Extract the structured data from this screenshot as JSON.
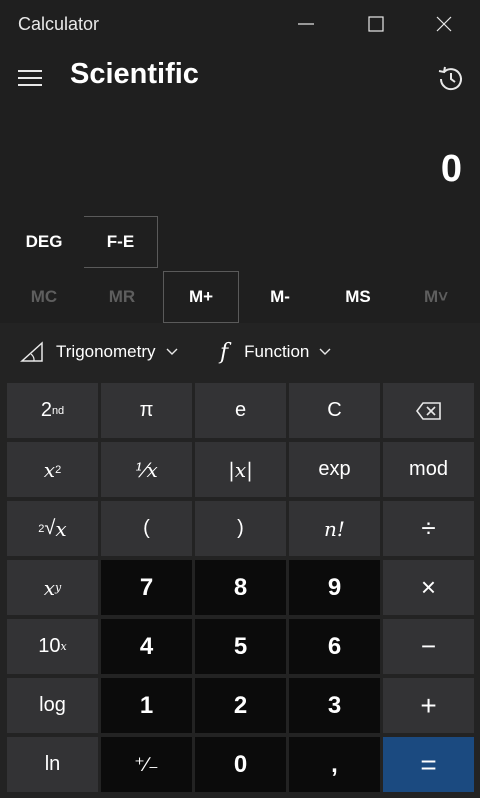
{
  "window": {
    "title": "Calculator"
  },
  "header": {
    "mode": "Scientific"
  },
  "display": {
    "value": "0"
  },
  "angle": {
    "deg": "DEG",
    "fe": "F-E"
  },
  "memory": {
    "mc": "MC",
    "mr": "MR",
    "mplus": "M+",
    "mminus": "M-",
    "ms": "MS",
    "mlist": "M˅"
  },
  "functions": {
    "trig": "Trigonometry",
    "func": "Function",
    "f": "f"
  },
  "keys": {
    "second_base": "2",
    "second_sup": "nd",
    "pi": "π",
    "e": "e",
    "clear": "C",
    "square_base": "x",
    "square_sup": "2",
    "reciprocal": "⅟x",
    "abs": "|x|",
    "exp": "exp",
    "mod": "mod",
    "sqrt_index": "2",
    "sqrt_sym": "√",
    "sqrt_x": "x",
    "lparen": "(",
    "rparen": ")",
    "factorial": "n!",
    "divide": "÷",
    "pow_base": "x",
    "pow_sup": "y",
    "seven": "7",
    "eight": "8",
    "nine": "9",
    "multiply": "×",
    "ten_base": "10",
    "ten_sup": "x",
    "four": "4",
    "five": "5",
    "six": "6",
    "minus": "−",
    "log": "log",
    "one": "1",
    "two": "2",
    "three": "3",
    "plus": "+",
    "ln": "ln",
    "negate": "⁺∕₋",
    "zero": "0",
    "decimal": ",",
    "equals": "="
  },
  "colors": {
    "background": "#1f1f1f",
    "function_key": "#333335",
    "number_key": "#0b0b0b",
    "equals_key": "#1b4a80",
    "disabled": "#5e5e5e"
  },
  "icons": {
    "minimize": "minimize-icon",
    "maximize": "maximize-icon",
    "close": "close-icon",
    "menu": "hamburger-icon",
    "history": "history-icon",
    "trig": "triangle-icon",
    "chevron": "chevron-down-icon",
    "backspace": "backspace-icon"
  }
}
